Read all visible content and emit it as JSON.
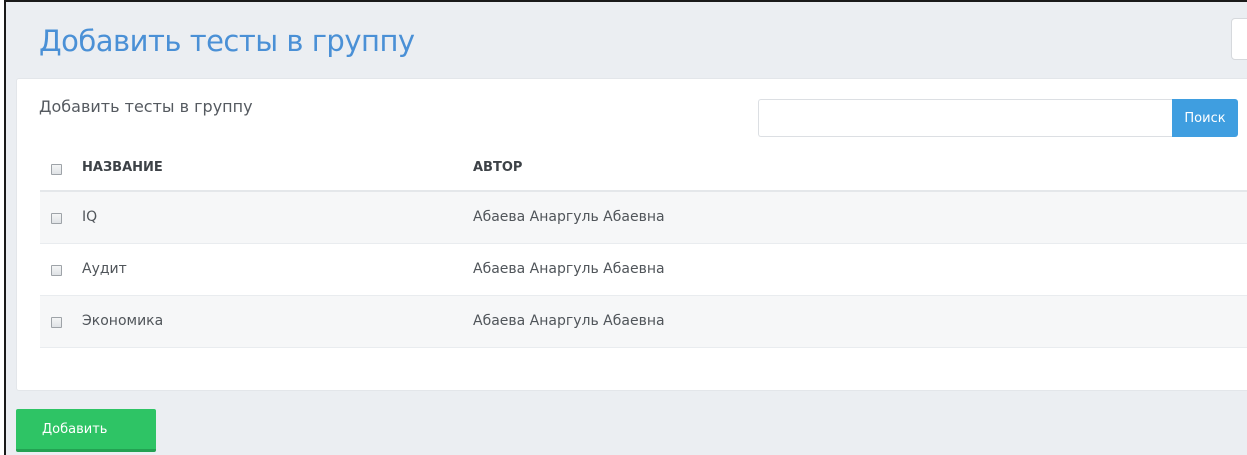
{
  "page": {
    "title": "Добавить тесты в группу"
  },
  "card": {
    "title": "Добавить тесты в группу"
  },
  "search": {
    "value": "",
    "placeholder": "",
    "button_label": "Поиск"
  },
  "table": {
    "columns": [
      "НАЗВАНИЕ",
      "АВТОР"
    ],
    "rows": [
      {
        "name": "IQ",
        "author": "Абаева Анаргуль Абаевна",
        "checked": false
      },
      {
        "name": "Аудит",
        "author": "Абаева Анаргуль Абаевна",
        "checked": false
      },
      {
        "name": "Экономика",
        "author": "Абаева Анаргуль Абаевна",
        "checked": false
      }
    ]
  },
  "footer": {
    "add_label": "Добавить"
  },
  "colors": {
    "title_blue": "#4a90d6",
    "search_button": "#3f9ee0",
    "add_button": "#2ec465",
    "page_background": "#ebeef2"
  }
}
